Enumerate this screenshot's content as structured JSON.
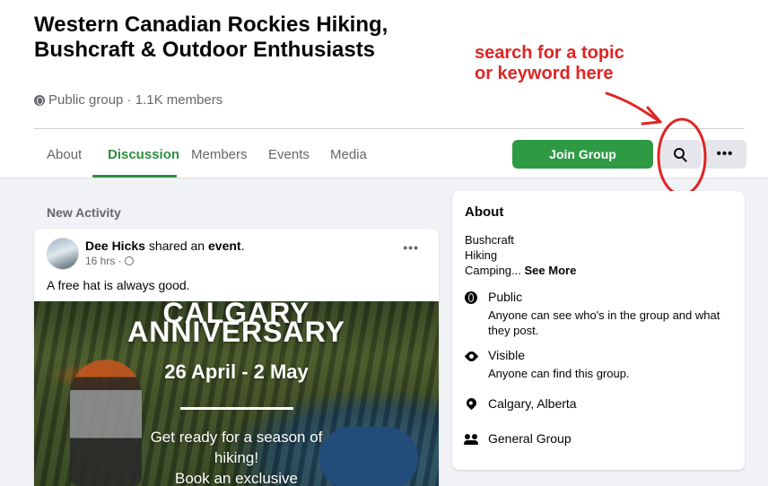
{
  "group": {
    "name": "Western Canadian Rockies Hiking, Bushcraft & Outdoor Enthusiasts",
    "meta": "Public group · 1.1K members",
    "privacy_icon": "globe-icon"
  },
  "tabs": [
    {
      "label": "About"
    },
    {
      "label": "Discussion",
      "active": true
    },
    {
      "label": "Members"
    },
    {
      "label": "Events"
    },
    {
      "label": "Media"
    }
  ],
  "actions": {
    "join_label": "Join Group",
    "search_icon": "search-icon",
    "more_icon": "more-icon"
  },
  "annotation": {
    "text": "search for a topic\nor keyword here",
    "color": "#e02424"
  },
  "feed": {
    "section_label": "New Activity",
    "post": {
      "author": "Dee Hicks",
      "verb": "shared an",
      "object": "event",
      "time": "16 hrs ·",
      "text": "A free hat is always good.",
      "event": {
        "line1": "CALGARY",
        "title": "ANNIVERSARY",
        "dates": "26 April - 2 May",
        "body_line1": "Get ready for a season of",
        "body_line2": "hiking!",
        "body_line3": "Book an exclusive"
      }
    }
  },
  "about": {
    "title": "About",
    "desc_lines": [
      "Bushcraft",
      "Hiking"
    ],
    "desc_truncated": "Camping...",
    "see_more": "See More",
    "items": [
      {
        "icon": "globe-icon",
        "title": "Public",
        "desc": "Anyone can see who's in the group and what they post."
      },
      {
        "icon": "eye-icon",
        "title": "Visible",
        "desc": "Anyone can find this group."
      },
      {
        "icon": "location-pin-icon",
        "title": "Calgary, Alberta",
        "desc": ""
      },
      {
        "icon": "people-icon",
        "title": "General Group",
        "desc": ""
      }
    ]
  },
  "colors": {
    "brand_green": "#2f9a44",
    "active_tab": "#2d8f3f",
    "annotation_red": "#e02424"
  }
}
